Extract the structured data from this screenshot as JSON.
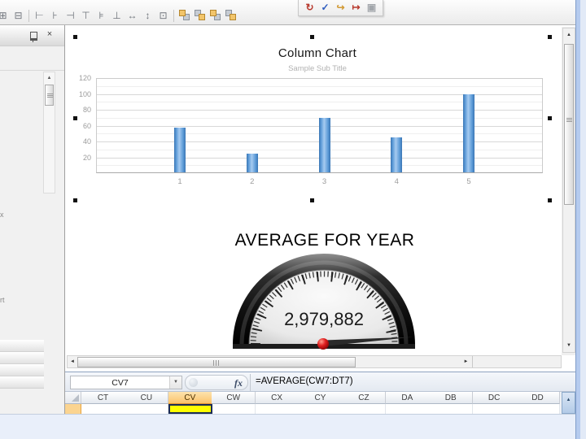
{
  "app_toolbar": {
    "layout_icons": [
      {
        "name": "group-icon",
        "glyph": "⊞"
      },
      {
        "name": "ungroup-icon",
        "glyph": "⊟"
      },
      {
        "name": "align-left-icon",
        "glyph": "⊢"
      },
      {
        "name": "align-center-icon",
        "glyph": "⊦"
      },
      {
        "name": "align-right-icon",
        "glyph": "⊣"
      },
      {
        "name": "align-top-icon",
        "glyph": "⊤"
      },
      {
        "name": "align-middle-icon",
        "glyph": "⊧"
      },
      {
        "name": "align-bottom-icon",
        "glyph": "⊥"
      },
      {
        "name": "same-width-icon",
        "glyph": "↔"
      },
      {
        "name": "same-height-icon",
        "glyph": "↕"
      },
      {
        "name": "same-size-icon",
        "glyph": "⊡"
      }
    ],
    "order_icons": [
      {
        "name": "bring-to-front-icon"
      },
      {
        "name": "send-to-back-icon"
      },
      {
        "name": "bring-forward-icon"
      },
      {
        "name": "send-backward-icon"
      }
    ],
    "floating_icons": [
      {
        "name": "refresh-icon",
        "glyph": "↻",
        "color": "#b83a2e"
      },
      {
        "name": "edit-icon",
        "glyph": "✓",
        "color": "#2d5bbf"
      },
      {
        "name": "redo-icon",
        "glyph": "↪",
        "color": "#d29a35"
      },
      {
        "name": "export-icon",
        "glyph": "↦",
        "color": "#b83a2e"
      },
      {
        "name": "save-icon",
        "glyph": "▣",
        "color": "#a2a6ab"
      }
    ]
  },
  "side_panel": {
    "close_glyph": "×",
    "clipped_labels": [
      "x",
      "rt"
    ]
  },
  "icons": {
    "scroll_up": "▲",
    "scroll_down": "▼",
    "scroll_left": "◄",
    "scroll_right": "►",
    "dropdown": "▼"
  },
  "formula_bar": {
    "name_box": "CV7",
    "fx": "fx",
    "formula": "=AVERAGE(CW7:DT7)"
  },
  "sheet": {
    "columns": [
      "CT",
      "CU",
      "CV",
      "CW",
      "CX",
      "CY",
      "CZ",
      "DA",
      "DB",
      "DC",
      "DD"
    ],
    "selected_column": "CV",
    "selected_cell_color": "#ffff00",
    "selected_header_color": "#fbc36b"
  },
  "chart_data": [
    {
      "type": "bar",
      "title": "Column Chart",
      "subtitle": "Sample Sub Title",
      "categories": [
        "1",
        "2",
        "3",
        "4",
        "5"
      ],
      "values": [
        57,
        25,
        70,
        45,
        100
      ],
      "ylim": [
        0,
        120
      ],
      "yticks": [
        20,
        40,
        60,
        80,
        100,
        120
      ],
      "minor_grid_step": 10,
      "grid": true,
      "legend": false,
      "bar_color": "#5b9bd5"
    },
    {
      "type": "gauge",
      "title": "AVERAGE FOR YEAR",
      "value": "2,979,882",
      "pivot_color": "#cc1111"
    }
  ]
}
